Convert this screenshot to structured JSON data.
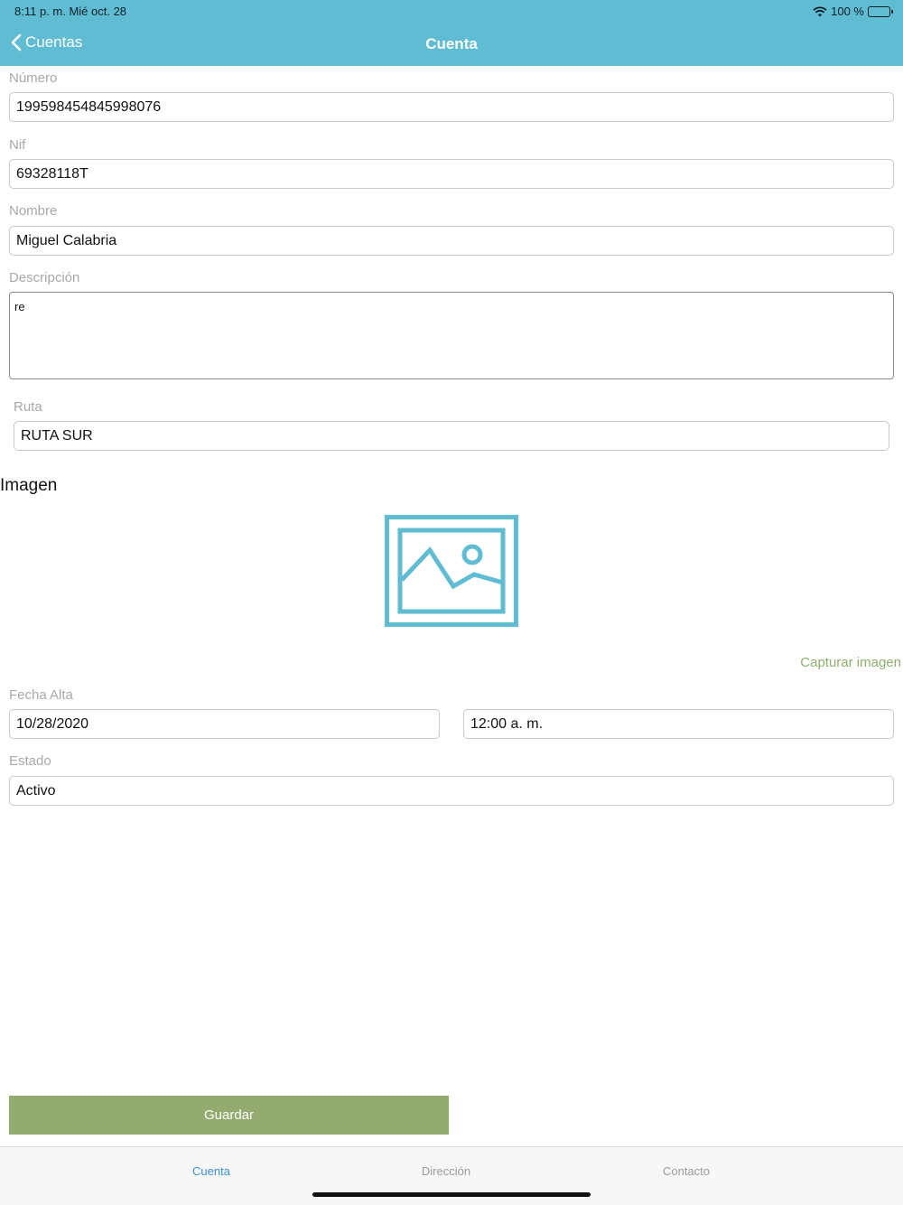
{
  "status_bar": {
    "time": "8:11 p. m.  Mié oct. 28",
    "battery": "100 %"
  },
  "nav": {
    "back_label": "Cuentas",
    "title": "Cuenta"
  },
  "form": {
    "numero": {
      "label": "Número",
      "value": "199598454845998076"
    },
    "nif": {
      "label": "Nif",
      "value": "69328118T"
    },
    "nombre": {
      "label": "Nombre",
      "value": "Miguel Calabria"
    },
    "descripcion": {
      "label": "Descripción",
      "value": "re"
    },
    "ruta": {
      "label": "Ruta",
      "value": "RUTA SUR"
    },
    "imagen": {
      "title": "Imagen",
      "capture_label": "Capturar imagen"
    },
    "fecha_alta": {
      "label": "Fecha Alta",
      "date": "10/28/2020",
      "time": "12:00 a. m."
    },
    "estado": {
      "label": "Estado",
      "value": "Activo"
    },
    "save_label": "Guardar"
  },
  "tabs": [
    {
      "label": "Cuenta",
      "active": true
    },
    {
      "label": "Dirección",
      "active": false
    },
    {
      "label": "Contacto",
      "active": false
    }
  ],
  "colors": {
    "header": "#5fbcd3",
    "accent_green": "#93ab6f",
    "active_tab": "#3a8fd6"
  },
  "icons": {
    "back": "chevron-left-icon",
    "wifi": "wifi-icon",
    "battery": "battery-icon",
    "image": "image-placeholder-icon"
  }
}
